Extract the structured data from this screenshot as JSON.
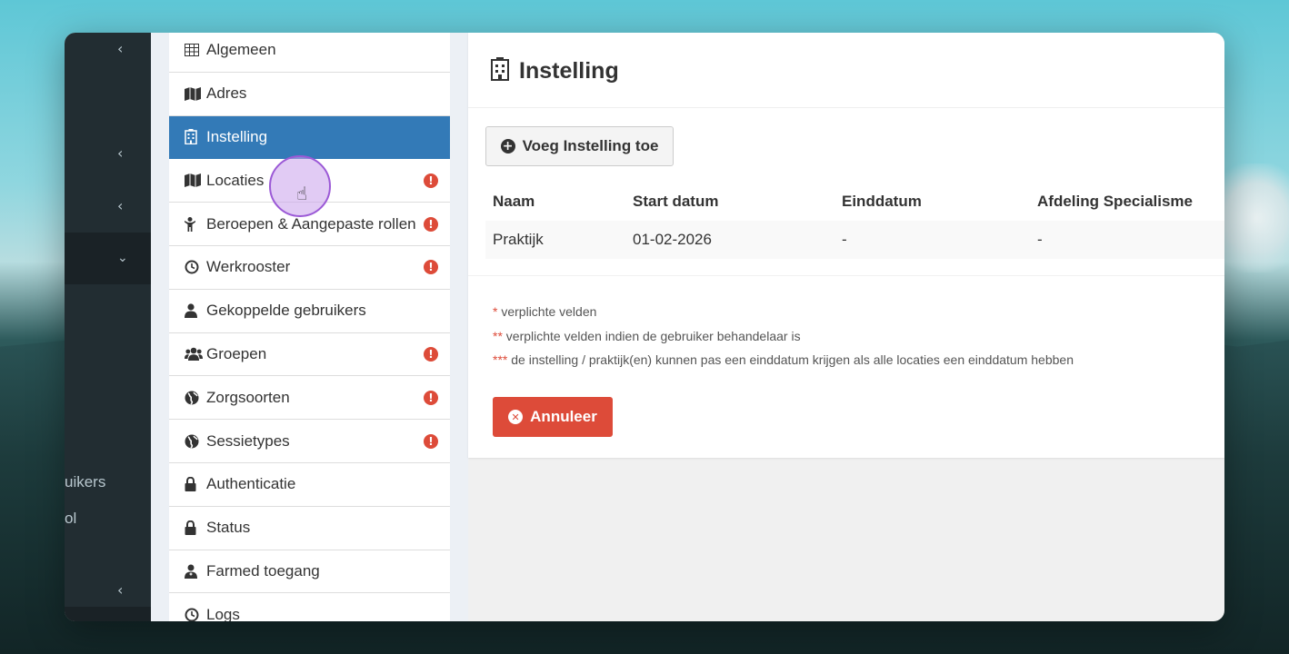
{
  "left_nav": {
    "partial_items": [
      "uikers",
      "ol"
    ]
  },
  "menu": {
    "items": [
      {
        "label": "Algemeen",
        "icon": "table-icon",
        "warning": false,
        "active": false
      },
      {
        "label": "Adres",
        "icon": "map-icon",
        "warning": false,
        "active": false
      },
      {
        "label": "Instelling",
        "icon": "building-icon",
        "warning": false,
        "active": true
      },
      {
        "label": "Locaties",
        "icon": "map-icon",
        "warning": true,
        "active": false
      },
      {
        "label": "Beroepen & Aangepaste rollen",
        "icon": "child-icon",
        "warning": true,
        "active": false
      },
      {
        "label": "Werkrooster",
        "icon": "clock-icon",
        "warning": true,
        "active": false
      },
      {
        "label": "Gekoppelde gebruikers",
        "icon": "user-icon",
        "warning": false,
        "active": false
      },
      {
        "label": "Groepen",
        "icon": "users-icon",
        "warning": true,
        "active": false
      },
      {
        "label": "Zorgsoorten",
        "icon": "globe-icon",
        "warning": true,
        "active": false
      },
      {
        "label": "Sessietypes",
        "icon": "globe-icon",
        "warning": true,
        "active": false
      },
      {
        "label": "Authenticatie",
        "icon": "lock-icon",
        "warning": false,
        "active": false
      },
      {
        "label": "Status",
        "icon": "lock-icon",
        "warning": false,
        "active": false
      },
      {
        "label": "Farmed toegang",
        "icon": "user-md-icon",
        "warning": false,
        "active": false
      },
      {
        "label": "Logs",
        "icon": "clock-icon",
        "warning": false,
        "active": false
      }
    ]
  },
  "main": {
    "title": "Instelling",
    "add_button": "Voeg Instelling toe",
    "table": {
      "headers": [
        "Naam",
        "Start datum",
        "Einddatum",
        "Afdeling Specialisme"
      ],
      "rows": [
        [
          "Praktijk",
          "01-02-2026",
          "-",
          "-"
        ]
      ]
    },
    "notes": [
      {
        "marker": "*",
        "text": " verplichte velden"
      },
      {
        "marker": "**",
        "text": " verplichte velden indien de gebruiker behandelaar is"
      },
      {
        "marker": "***",
        "text": " de instelling / praktijk(en) kunnen pas een einddatum krijgen als alle locaties een einddatum hebben"
      }
    ],
    "cancel_button": "Annuleer"
  },
  "colors": {
    "active": "#337ab7",
    "danger": "#dd4b39",
    "sidebar": "#222d32"
  }
}
